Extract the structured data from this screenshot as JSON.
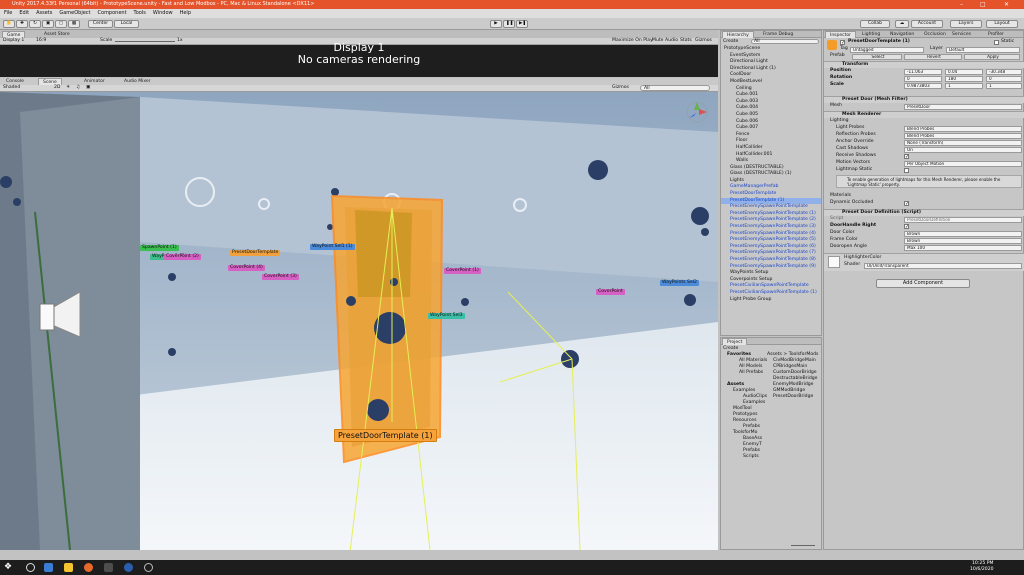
{
  "window": {
    "title": "Unity 2017.4.33f1 Personal (64bit) - PrototypeScene.unity - Fast and Low Modbox - PC, Mac & Linux Standalone <DX11>"
  },
  "menu": [
    "File",
    "Edit",
    "Assets",
    "GameObject",
    "Component",
    "Tools",
    "Window",
    "Help"
  ],
  "toolbar": {
    "pivot": "Center",
    "space": "Local",
    "collab": "Collab",
    "account": "Account",
    "layers": "Layers",
    "layout": "Layout"
  },
  "game": {
    "tab_game": "Game",
    "tab_asset_store": "Asset Store",
    "display": "Display 1",
    "aspect": "16:9",
    "scale_label": "Scale",
    "scale_value": "1x",
    "maximize": "Maximize On Play",
    "mute": "Mute Audio",
    "stats": "Stats",
    "gizmos": "Gizmos",
    "message_title": "Display 1",
    "message_body": "No cameras rendering"
  },
  "scene": {
    "tab_console": "Console",
    "tab_scene": "Scene",
    "tab_animator": "Animator",
    "tab_audio": "Audio Mixer",
    "shading": "Shaded",
    "mode_2d": "2D",
    "gizmos": "Gizmos",
    "search": "All",
    "labels": {
      "door_label": "PresetDoorTemplate (1)",
      "spawn_a": "SpawnPoint (1)",
      "spawn_b": "CoverPoint (2)",
      "spawn_c": "PresetDoorTemplate",
      "spawn_d": "CoverPoint (4)",
      "spawn_e": "CoverPoint (3)",
      "waypoint_a": "WayPoint Sel1 (1)",
      "waypoint_b": "WayPoint Sel3",
      "cover_a": "CoverPoint (1)",
      "cover_b": "CoverPoint",
      "waypoint_c": "WayPoints Sel2"
    }
  },
  "hierarchy": {
    "tab": "Hierarchy",
    "tab2": "Frame Debug",
    "create": "Create",
    "search": "All",
    "items": [
      {
        "t": "PrototypeScene",
        "i": 0,
        "c": "d"
      },
      {
        "t": "EventSystem",
        "i": 1,
        "c": "d"
      },
      {
        "t": "Directional Light",
        "i": 1,
        "c": "d"
      },
      {
        "t": "Directional Light (1)",
        "i": 1,
        "c": "d"
      },
      {
        "t": "CoolDoor",
        "i": 1,
        "c": "d"
      },
      {
        "t": "ModBestLevel",
        "i": 1,
        "c": "d"
      },
      {
        "t": "Ceiling",
        "i": 2,
        "c": "d"
      },
      {
        "t": "Cube.001",
        "i": 2,
        "c": "d"
      },
      {
        "t": "Cube.003",
        "i": 2,
        "c": "d"
      },
      {
        "t": "Cube.004",
        "i": 2,
        "c": "d"
      },
      {
        "t": "Cube.005",
        "i": 2,
        "c": "d"
      },
      {
        "t": "Cube.006",
        "i": 2,
        "c": "d"
      },
      {
        "t": "Cube.007",
        "i": 2,
        "c": "d"
      },
      {
        "t": "Fence",
        "i": 2,
        "c": "d"
      },
      {
        "t": "Floor",
        "i": 2,
        "c": "d"
      },
      {
        "t": "HalfCollider",
        "i": 2,
        "c": "d"
      },
      {
        "t": "HalfCollider.001",
        "i": 2,
        "c": "d"
      },
      {
        "t": "Walls",
        "i": 2,
        "c": "d"
      },
      {
        "t": "Glass (DESTRUCTABLE)",
        "i": 1,
        "c": "d"
      },
      {
        "t": "Glass (DESTRUCTABLE) (1)",
        "i": 1,
        "c": "d"
      },
      {
        "t": "Lights",
        "i": 1,
        "c": "d"
      },
      {
        "t": "GameManagerPrefab",
        "i": 1,
        "c": "b"
      },
      {
        "t": "PresetDoorTemplate",
        "i": 1,
        "c": "b"
      },
      {
        "t": "PresetDoorTemplate (1)",
        "i": 1,
        "c": "s"
      },
      {
        "t": "PresetEnemySpawnPointTemplate",
        "i": 1,
        "c": "b"
      },
      {
        "t": "PresetEnemySpawnPointTemplate (1)",
        "i": 1,
        "c": "b"
      },
      {
        "t": "PresetEnemySpawnPointTemplate (2)",
        "i": 1,
        "c": "b"
      },
      {
        "t": "PresetEnemySpawnPointTemplate (3)",
        "i": 1,
        "c": "b"
      },
      {
        "t": "PresetEnemySpawnPointTemplate (4)",
        "i": 1,
        "c": "b"
      },
      {
        "t": "PresetEnemySpawnPointTemplate (5)",
        "i": 1,
        "c": "b"
      },
      {
        "t": "PresetEnemySpawnPointTemplate (6)",
        "i": 1,
        "c": "b"
      },
      {
        "t": "PresetEnemySpawnPointTemplate (7)",
        "i": 1,
        "c": "b"
      },
      {
        "t": "PresetEnemySpawnPointTemplate (8)",
        "i": 1,
        "c": "b"
      },
      {
        "t": "PresetEnemySpawnPointTemplate (9)",
        "i": 1,
        "c": "b"
      },
      {
        "t": "WayPoints Setup",
        "i": 1,
        "c": "d"
      },
      {
        "t": "Coverpoints Setup",
        "i": 1,
        "c": "d"
      },
      {
        "t": "PresetCivilianSpawnPointTemplate",
        "i": 1,
        "c": "b"
      },
      {
        "t": "PresetCivilianSpawnPointTemplate (1)",
        "i": 1,
        "c": "b"
      },
      {
        "t": "Light Probe Group",
        "i": 1,
        "c": "d"
      }
    ]
  },
  "project": {
    "tab": "Project",
    "create": "Create",
    "favorites": "Favorites",
    "fav_items": [
      "All Materials",
      "All Models",
      "All Prefabs"
    ],
    "assets": "Assets",
    "tree": [
      "Examples",
      "AudioClips",
      "Examples",
      "ModTool",
      "Prototypes",
      "Resources",
      "Prefabs",
      "ToolsforMo",
      "BaseAss",
      "EnemyT",
      "Prefabs",
      "Scripts"
    ],
    "breadcrumb": "Assets > ToolsforMods",
    "files": [
      "CivModBridgeMain",
      "CPBridgesMain",
      "CustomDoorBridge",
      "DestructableBridge",
      "EnemyModBridge",
      "GMModBridge",
      "PresetDoorBridge"
    ]
  },
  "inspector": {
    "tab": "Inspector",
    "tab2": "Lighting",
    "tab3": "Navigation",
    "tab4": "Occlusion",
    "tab5": "Services",
    "tab6": "Profiler",
    "object_name": "PresetDoorTemplate (1)",
    "static": "Static",
    "tag_label": "Tag",
    "tag": "Untagged",
    "layer_label": "Layer",
    "layer": "Default",
    "prefab_label": "Prefab",
    "select": "Select",
    "revert": "Revert",
    "apply": "Apply",
    "transform": {
      "title": "Transform",
      "position": "Position",
      "rotation": "Rotation",
      "scale": "Scale",
      "pos": [
        "-11.063",
        "0.04",
        "-30.348"
      ],
      "rot": [
        "0",
        "180",
        "0"
      ],
      "scl": [
        "0.9873803",
        "1",
        "1"
      ]
    },
    "meshfilter": {
      "title": "Preset Door (Mesh Filter)",
      "mesh_label": "Mesh",
      "mesh": "PresetDoor"
    },
    "meshrenderer": {
      "title": "Mesh Renderer",
      "lighting": "Lighting",
      "rows": [
        [
          "Light Probes",
          "Blend Probes"
        ],
        [
          "Reflection Probes",
          "Blend Probes"
        ],
        [
          "Anchor Override",
          "None (Transform)"
        ],
        [
          "Cast Shadows",
          "On"
        ],
        [
          "Receive Shadows",
          ""
        ],
        [
          "Motion Vectors",
          "Per Object Motion"
        ],
        [
          "Lightmap Static",
          ""
        ]
      ],
      "note": "To enable generation of lightmaps for this Mesh Renderer, please enable the 'Lightmap Static' property.",
      "materials": "Materials",
      "dynamic_occluded": "Dynamic Occluded"
    },
    "script": {
      "title": "Preset Door Definition (Script)",
      "script_label": "Script",
      "script": "PresetDoorDefinition",
      "rows": [
        [
          "DoorHandle Right",
          ""
        ],
        [
          "Door Color",
          "Brown"
        ],
        [
          "Frame Color",
          "Brown"
        ],
        [
          "Dooropen Angle",
          "Max 100"
        ]
      ]
    },
    "material": {
      "name": "HighlighterColor",
      "shader_label": "Shader",
      "shader": "UI/Unlit/Transparent"
    },
    "add_component": "Add Component"
  },
  "taskbar": {
    "time": "10:25 PM",
    "date": "10/6/2020"
  }
}
